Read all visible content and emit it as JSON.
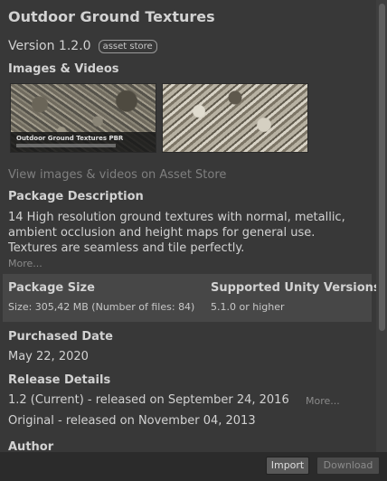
{
  "package": {
    "title": "Outdoor Ground Textures",
    "version": "Version 1.2.0",
    "badge": "asset store"
  },
  "media": {
    "heading": "Images & Videos",
    "thumbnail_caption": "Outdoor Ground Textures PBR",
    "view_link": "View images & videos on Asset Store"
  },
  "description": {
    "heading": "Package Description",
    "text": "14 High resolution ground textures with normal, metallic, ambient occlusion and height maps for general use. Textures are seamless and tile perfectly.",
    "more": "More..."
  },
  "size": {
    "heading": "Package Size",
    "value": "Size: 305,42 MB (Number of files: 84)"
  },
  "unity": {
    "heading": "Supported Unity Versions",
    "value": "5.1.0 or higher"
  },
  "purchase": {
    "heading": "Purchased Date",
    "value": "May 22, 2020"
  },
  "release": {
    "heading": "Release Details",
    "current": "1.2 (Current) - released on September 24,  2016",
    "more": "More...",
    "original": "Original - released on November 04,  2013"
  },
  "author": {
    "heading": "Author"
  },
  "buttons": {
    "import": "Import",
    "download": "Download"
  }
}
